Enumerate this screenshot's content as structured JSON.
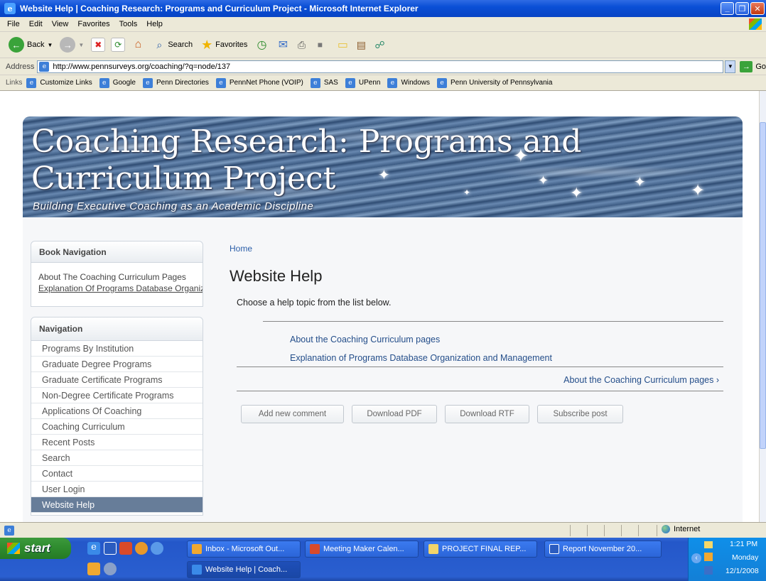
{
  "window": {
    "title": "Website Help | Coaching Research: Programs and Curriculum Project - Microsoft Internet Explorer"
  },
  "menu": [
    "File",
    "Edit",
    "View",
    "Favorites",
    "Tools",
    "Help"
  ],
  "toolbar": {
    "back": "Back",
    "search": "Search",
    "favorites": "Favorites"
  },
  "address": {
    "label": "Address",
    "url": "http://www.pennsurveys.org/coaching/?q=node/137",
    "go": "Go"
  },
  "links": {
    "label": "Links",
    "items": [
      "Customize Links",
      "Google",
      "Penn Directories",
      "PennNet Phone (VOIP)",
      "SAS",
      "UPenn",
      "Windows",
      "Penn University of Pennsylvania"
    ]
  },
  "site": {
    "title": "Coaching Research: Programs and Curriculum Project",
    "slogan": "Building Executive Coaching as an Academic Discipline"
  },
  "book_nav": {
    "heading": "Book Navigation",
    "items": [
      "About The Coaching Curriculum Pages",
      "Explanation Of Programs Database Organization and Management"
    ]
  },
  "navigation": {
    "heading": "Navigation",
    "items": [
      "Programs By Institution",
      "Graduate Degree Programs",
      "Graduate Certificate Programs",
      "Non-Degree Certificate Programs",
      "Applications Of Coaching",
      "Coaching Curriculum",
      "Recent Posts",
      "Search",
      "Contact",
      "User Login",
      "Website Help"
    ],
    "active_index": 10
  },
  "main": {
    "breadcrumb": "Home",
    "title": "Website Help",
    "intro": "Choose a help topic from the list below.",
    "topics": [
      "About the Coaching Curriculum pages",
      "Explanation of Programs Database Organization and Management"
    ],
    "next_link": "About the Coaching Curriculum pages ›",
    "buttons": [
      "Add new comment",
      "Download PDF",
      "Download RTF",
      "Subscribe post"
    ]
  },
  "status": {
    "zone": "Internet"
  },
  "taskbar": {
    "start": "start",
    "tasks": [
      "Inbox - Microsoft Out...",
      "Meeting Maker Calen...",
      "PROJECT FINAL REP...",
      "Report November 20...",
      "Website Help | Coach..."
    ],
    "clock": {
      "time": "1:21 PM",
      "day": "Monday",
      "date": "12/1/2008"
    }
  }
}
